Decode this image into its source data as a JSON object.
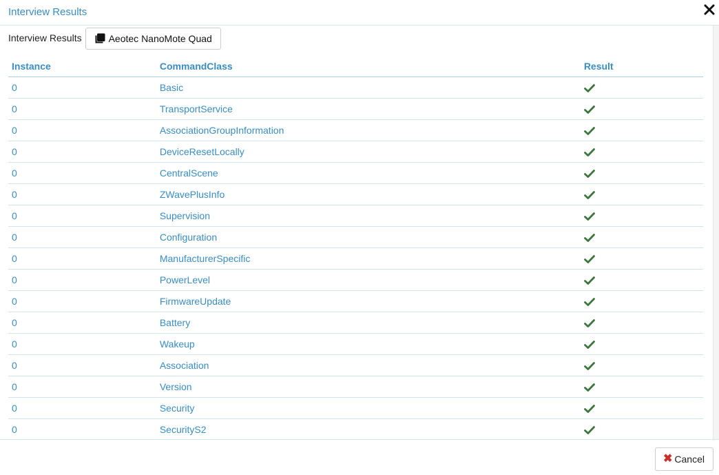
{
  "modal": {
    "title": "Interview Results",
    "close_icon": "close-icon"
  },
  "toolbar": {
    "label": "Interview Results",
    "device_button": "Aeotec NanoMote Quad",
    "device_icon": "clone-icon"
  },
  "table": {
    "headers": [
      "Instance",
      "CommandClass",
      "Result"
    ],
    "rows": [
      {
        "instance": "0",
        "command_class": "Basic",
        "result": "check-icon"
      },
      {
        "instance": "0",
        "command_class": "TransportService",
        "result": "check-icon"
      },
      {
        "instance": "0",
        "command_class": "AssociationGroupInformation",
        "result": "check-icon"
      },
      {
        "instance": "0",
        "command_class": "DeviceResetLocally",
        "result": "check-icon"
      },
      {
        "instance": "0",
        "command_class": "CentralScene",
        "result": "check-icon"
      },
      {
        "instance": "0",
        "command_class": "ZWavePlusInfo",
        "result": "check-icon"
      },
      {
        "instance": "0",
        "command_class": "Supervision",
        "result": "check-icon"
      },
      {
        "instance": "0",
        "command_class": "Configuration",
        "result": "check-icon"
      },
      {
        "instance": "0",
        "command_class": "ManufacturerSpecific",
        "result": "check-icon"
      },
      {
        "instance": "0",
        "command_class": "PowerLevel",
        "result": "check-icon"
      },
      {
        "instance": "0",
        "command_class": "FirmwareUpdate",
        "result": "check-icon"
      },
      {
        "instance": "0",
        "command_class": "Battery",
        "result": "check-icon"
      },
      {
        "instance": "0",
        "command_class": "Wakeup",
        "result": "check-icon"
      },
      {
        "instance": "0",
        "command_class": "Association",
        "result": "check-icon"
      },
      {
        "instance": "0",
        "command_class": "Version",
        "result": "check-icon"
      },
      {
        "instance": "0",
        "command_class": "Security",
        "result": "check-icon"
      },
      {
        "instance": "0",
        "command_class": "SecurityS2",
        "result": "check-icon"
      }
    ]
  },
  "footer": {
    "cancel_label": "Cancel"
  },
  "colors": {
    "accent": "#3a8dc5",
    "success": "#3c763d",
    "danger": "#c9302c"
  }
}
